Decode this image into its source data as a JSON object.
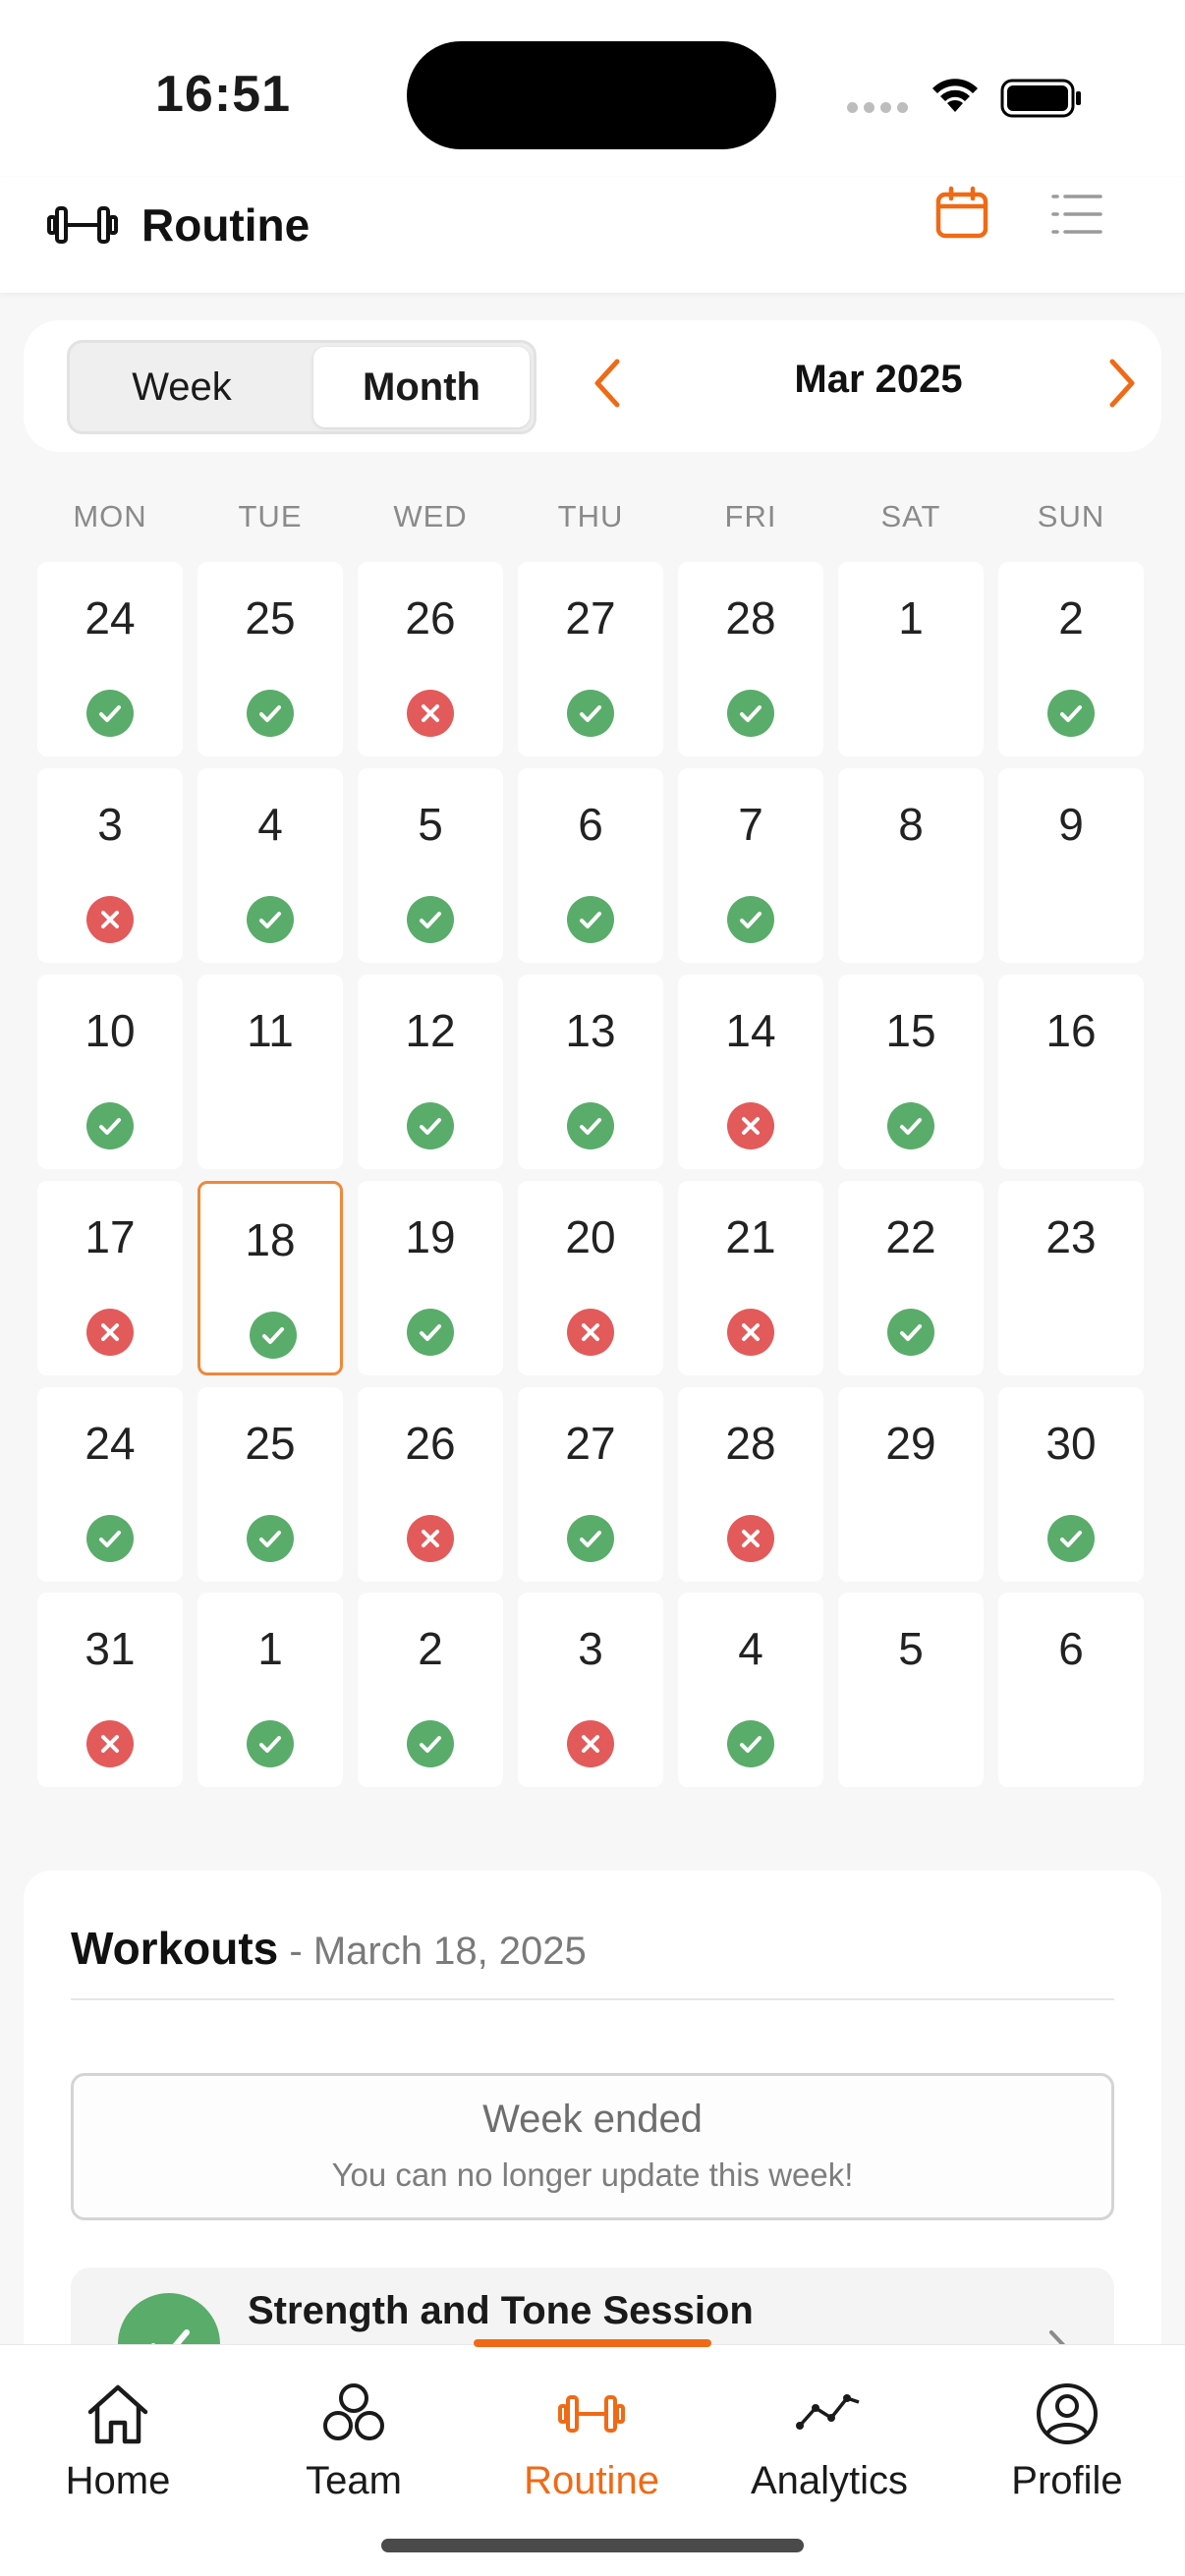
{
  "status_bar": {
    "time": "16:51"
  },
  "header": {
    "title": "Routine",
    "logo_icon": "dumbbell-icon",
    "view_icons": [
      "calendar-icon",
      "list-icon"
    ],
    "accent_color": "#f06a16"
  },
  "controls": {
    "segments": {
      "week": "Week",
      "month": "Month"
    },
    "selected_segment": "Month",
    "month_label": "Mar 2025"
  },
  "calendar": {
    "weekdays": [
      "MON",
      "TUE",
      "WED",
      "THU",
      "FRI",
      "SAT",
      "SUN"
    ],
    "selected_day": "18",
    "status_colors": {
      "done": "#5aac6a",
      "missed": "#e35a5a"
    },
    "weeks": [
      [
        {
          "day": "24",
          "status": "done"
        },
        {
          "day": "25",
          "status": "done"
        },
        {
          "day": "26",
          "status": "missed"
        },
        {
          "day": "27",
          "status": "done"
        },
        {
          "day": "28",
          "status": "done"
        },
        {
          "day": "1",
          "status": ""
        },
        {
          "day": "2",
          "status": "done"
        }
      ],
      [
        {
          "day": "3",
          "status": "missed"
        },
        {
          "day": "4",
          "status": "done"
        },
        {
          "day": "5",
          "status": "done"
        },
        {
          "day": "6",
          "status": "done"
        },
        {
          "day": "7",
          "status": "done"
        },
        {
          "day": "8",
          "status": ""
        },
        {
          "day": "9",
          "status": ""
        }
      ],
      [
        {
          "day": "10",
          "status": "done"
        },
        {
          "day": "11",
          "status": ""
        },
        {
          "day": "12",
          "status": "done"
        },
        {
          "day": "13",
          "status": "done"
        },
        {
          "day": "14",
          "status": "missed"
        },
        {
          "day": "15",
          "status": "done"
        },
        {
          "day": "16",
          "status": ""
        }
      ],
      [
        {
          "day": "17",
          "status": "missed"
        },
        {
          "day": "18",
          "status": "done"
        },
        {
          "day": "19",
          "status": "done"
        },
        {
          "day": "20",
          "status": "missed"
        },
        {
          "day": "21",
          "status": "missed"
        },
        {
          "day": "22",
          "status": "done"
        },
        {
          "day": "23",
          "status": ""
        }
      ],
      [
        {
          "day": "24",
          "status": "done"
        },
        {
          "day": "25",
          "status": "done"
        },
        {
          "day": "26",
          "status": "missed"
        },
        {
          "day": "27",
          "status": "done"
        },
        {
          "day": "28",
          "status": "missed"
        },
        {
          "day": "29",
          "status": ""
        },
        {
          "day": "30",
          "status": "done"
        }
      ],
      [
        {
          "day": "31",
          "status": "missed"
        },
        {
          "day": "1",
          "status": "done"
        },
        {
          "day": "2",
          "status": "done"
        },
        {
          "day": "3",
          "status": "missed"
        },
        {
          "day": "4",
          "status": "done"
        },
        {
          "day": "5",
          "status": ""
        },
        {
          "day": "6",
          "status": ""
        }
      ]
    ]
  },
  "workouts": {
    "title": "Workouts",
    "date": " - March 18, 2025",
    "notice_title": "Week ended",
    "notice_subtitle": "You can no longer update this week!",
    "session_title": "Strength and Tone Session"
  },
  "tab_bar": {
    "tabs": [
      {
        "label": "Home",
        "icon": "home-icon"
      },
      {
        "label": "Team",
        "icon": "team-icon"
      },
      {
        "label": "Routine",
        "icon": "dumbbell-icon"
      },
      {
        "label": "Analytics",
        "icon": "analytics-icon"
      },
      {
        "label": "Profile",
        "icon": "profile-icon"
      }
    ],
    "active": "Routine"
  }
}
